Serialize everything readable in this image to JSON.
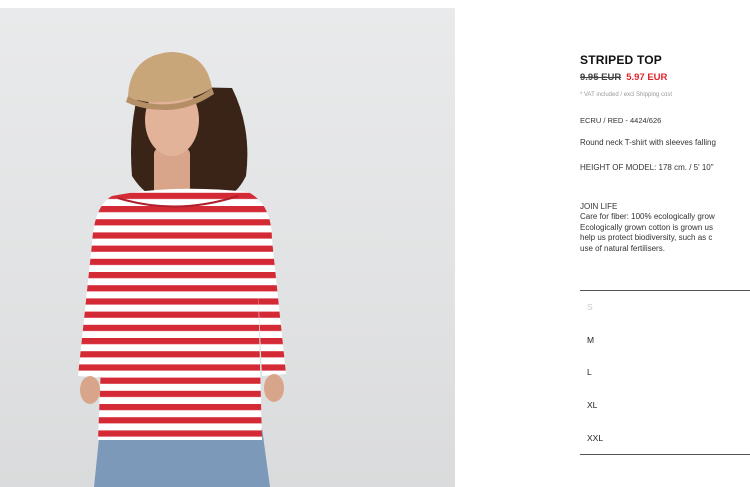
{
  "product": {
    "title": "STRIPED TOP",
    "old_price": "9.95 EUR",
    "new_price": "5.97 EUR",
    "vat_note": "* VAT included / excl Shipping cost",
    "reference": "ECRU / RED - 4424/626",
    "description": "Round neck T-shirt with sleeves falling",
    "model_height": "HEIGHT OF MODEL: 178 cm. / 5' 10\""
  },
  "join_life": {
    "title": "JOIN LIFE",
    "lines": [
      "Care for fiber: 100% ecologically grow",
      "Ecologically grown cotton is grown us",
      "help us protect biodiversity, such as c",
      "use of natural fertilisers."
    ]
  },
  "sizes": [
    {
      "label": "S",
      "available": false
    },
    {
      "label": "M",
      "available": true
    },
    {
      "label": "L",
      "available": true
    },
    {
      "label": "XL",
      "available": true
    },
    {
      "label": "XXL",
      "available": true
    }
  ],
  "colors": {
    "sale_price": "#e0232b",
    "stripe_red": "#d42a36",
    "stripe_white": "#ffffff",
    "cap": "#c9a57a",
    "denim": "#7c99b9"
  }
}
